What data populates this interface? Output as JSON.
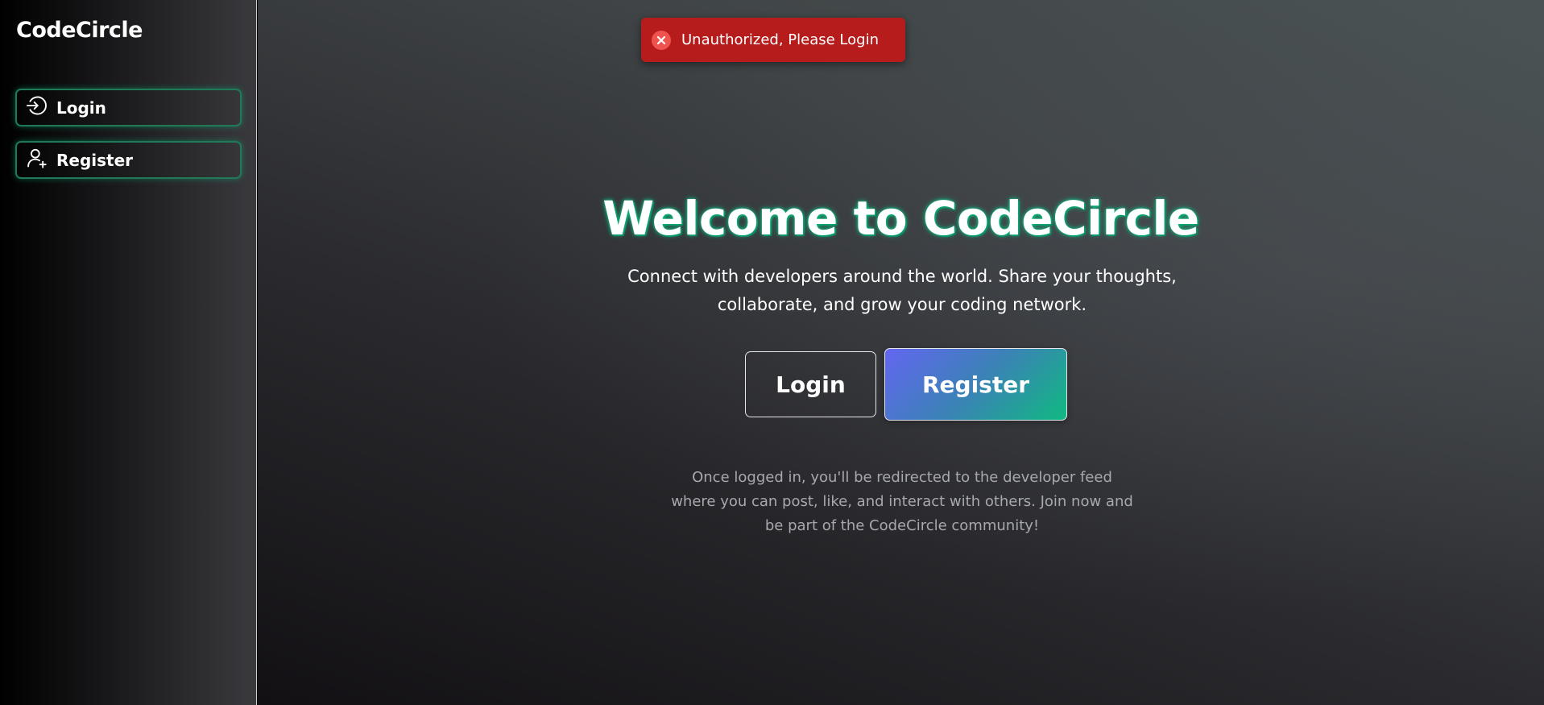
{
  "sidebar": {
    "brand": "CodeCircle",
    "items": [
      {
        "label": "Login",
        "icon": "login-icon"
      },
      {
        "label": "Register",
        "icon": "user-plus-icon"
      }
    ]
  },
  "toast": {
    "message": "Unauthorized, Please Login",
    "icon": "error-x-icon",
    "color": "#b71c1c"
  },
  "hero": {
    "title": "Welcome to CodeCircle",
    "subtitle": "Connect with developers around the world. Share your thoughts, collaborate, and grow your coding network.",
    "login_label": "Login",
    "register_label": "Register",
    "note": "Once logged in, you'll be redirected to the developer feed where you can post, like, and interact with others. Join now and be part of the CodeCircle community!"
  },
  "colors": {
    "accent_green": "#10b981",
    "accent_indigo": "#6366f1",
    "toast_red": "#b71c1c"
  }
}
